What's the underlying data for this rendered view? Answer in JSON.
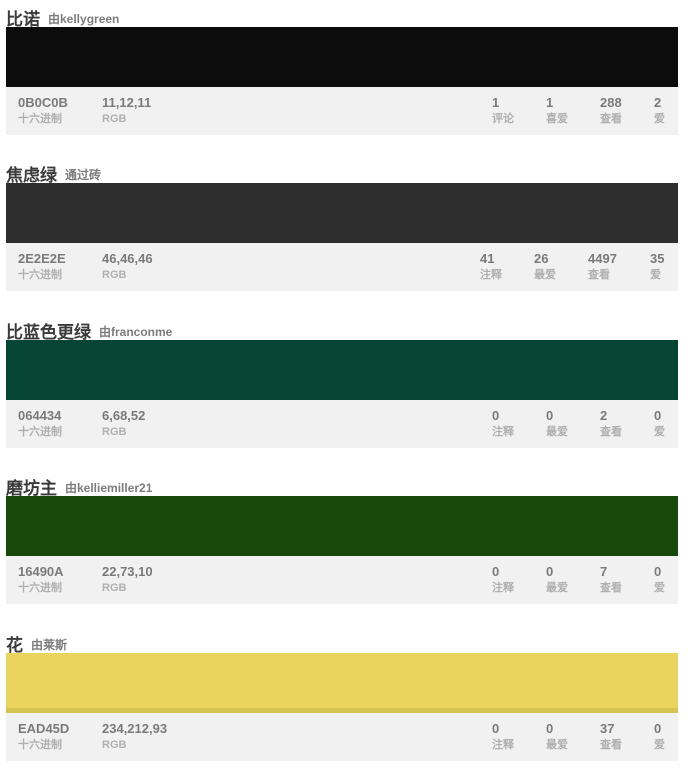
{
  "colors": [
    {
      "name": "比诺",
      "author": "由kellygreen",
      "hex": "0B0C0B",
      "hex_label": "十六进制",
      "rgb": "11,12,11",
      "rgb_label": "RGB",
      "swatch_color": "#0B0C0B",
      "stats": [
        {
          "value": "1",
          "label": "评论"
        },
        {
          "value": "1",
          "label": "喜爱"
        },
        {
          "value": "288",
          "label": "查看"
        },
        {
          "value": "2",
          "label": "爱"
        }
      ]
    },
    {
      "name": "焦虑绿",
      "author": "通过砖",
      "hex": "2E2E2E",
      "hex_label": "十六进制",
      "rgb": "46,46,46",
      "rgb_label": "RGB",
      "swatch_color": "#2E2E2E",
      "stats": [
        {
          "value": "41",
          "label": "注释"
        },
        {
          "value": "26",
          "label": "最爱"
        },
        {
          "value": "4497",
          "label": "查看"
        },
        {
          "value": "35",
          "label": "爱"
        }
      ]
    },
    {
      "name": "比蓝色更绿",
      "author": "由franconme",
      "hex": "064434",
      "hex_label": "十六进制",
      "rgb": "6,68,52",
      "rgb_label": "RGB",
      "swatch_color": "#064434",
      "stats": [
        {
          "value": "0",
          "label": "注释"
        },
        {
          "value": "0",
          "label": "最爱"
        },
        {
          "value": "2",
          "label": "查看"
        },
        {
          "value": "0",
          "label": "爱"
        }
      ]
    },
    {
      "name": "磨坊主",
      "author": "由kelliemiller21",
      "hex": "16490A",
      "hex_label": "十六进制",
      "rgb": "22,73,10",
      "rgb_label": "RGB",
      "swatch_color": "#16490A",
      "stats": [
        {
          "value": "0",
          "label": "注释"
        },
        {
          "value": "0",
          "label": "最爱"
        },
        {
          "value": "7",
          "label": "查看"
        },
        {
          "value": "0",
          "label": "爱"
        }
      ]
    },
    {
      "name": "花",
      "author": "由莱斯",
      "hex": "EAD45D",
      "hex_label": "十六进制",
      "rgb": "234,212,93",
      "rgb_label": "RGB",
      "swatch_color": "#EAD45D",
      "stats": [
        {
          "value": "0",
          "label": "注释"
        },
        {
          "value": "0",
          "label": "最爱"
        },
        {
          "value": "37",
          "label": "查看"
        },
        {
          "value": "0",
          "label": "爱"
        }
      ]
    }
  ]
}
